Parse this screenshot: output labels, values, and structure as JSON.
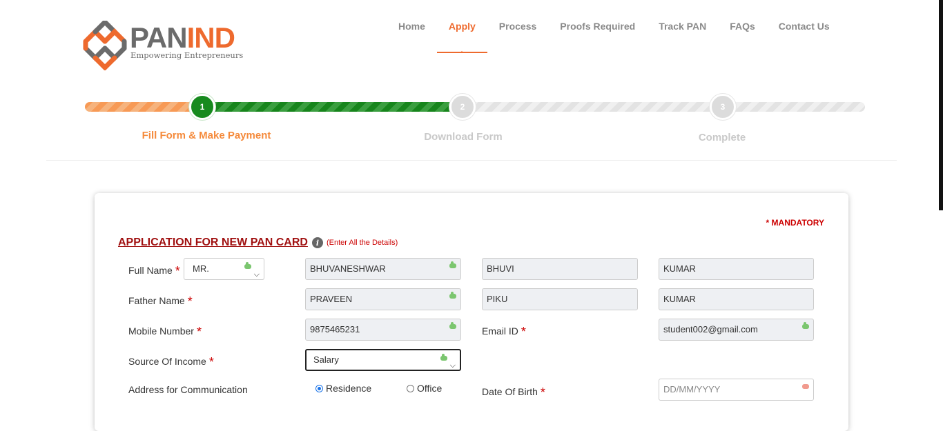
{
  "logo": {
    "brand_pan": "PAN",
    "brand_ind": "IND",
    "tagline": "Empowering Entrepreneurs"
  },
  "nav": {
    "items": [
      {
        "label": "Home"
      },
      {
        "label": "Apply"
      },
      {
        "label": "Process"
      },
      {
        "label": "Proofs Required"
      },
      {
        "label": "Track PAN"
      },
      {
        "label": "FAQs"
      },
      {
        "label": "Contact Us"
      }
    ],
    "active": "Apply"
  },
  "steps": [
    {
      "number": "1",
      "label": "Fill Form & Make Payment",
      "status": "current"
    },
    {
      "number": "2",
      "label": "Download Form",
      "status": "pending"
    },
    {
      "number": "3",
      "label": "Complete",
      "status": "pending"
    }
  ],
  "form": {
    "mandatory_note": "* MANDATORY",
    "title": "APPLICATION FOR NEW PAN CARD",
    "hint": "(Enter All the Details)",
    "full_name": {
      "label": "Full Name",
      "req": "*",
      "title": "MR.",
      "first": "BHUVANESHWAR",
      "middle": "BHUVI",
      "last": "KUMAR"
    },
    "father_name": {
      "label": "Father Name",
      "req": "*",
      "first": "PRAVEEN",
      "middle": "PIKU",
      "last": "KUMAR"
    },
    "mobile": {
      "label": "Mobile Number",
      "req": "*",
      "value": "9875465231"
    },
    "email": {
      "label": "Email ID",
      "req": "*",
      "value": "student002@gmail.com"
    },
    "income": {
      "label": "Source Of Income",
      "req": "*",
      "value": "Salary"
    },
    "address": {
      "label": "Address for Communication",
      "residence": "Residence",
      "office": "Office",
      "selected": "Residence"
    },
    "dob": {
      "label": "Date Of Birth",
      "req": "*",
      "placeholder": "DD/MM/YYYY"
    }
  },
  "colors": {
    "accent": "#ee6a2e",
    "success": "#178a1e",
    "error": "#cc0000"
  }
}
